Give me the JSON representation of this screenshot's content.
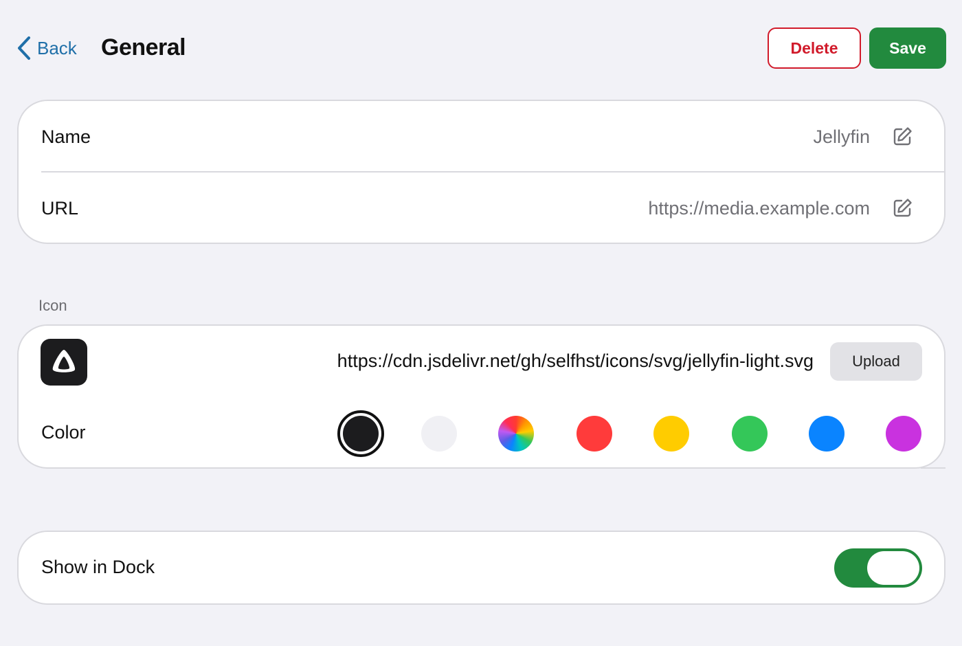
{
  "header": {
    "back_label": "Back",
    "title": "General",
    "delete_label": "Delete",
    "save_label": "Save"
  },
  "fields": {
    "name_label": "Name",
    "name_value": "Jellyfin",
    "url_label": "URL",
    "url_value": "https://media.example.com"
  },
  "icon_section": {
    "section_label": "Icon",
    "icon_url": "https://cdn.jsdelivr.net/gh/selfhst/icons/svg/jellyfin-light.svg",
    "upload_label": "Upload",
    "color_label": "Color",
    "colors": [
      {
        "name": "black",
        "value": "#1c1c1e",
        "selected": true
      },
      {
        "name": "light",
        "value": "#f0f0f4",
        "selected": false
      },
      {
        "name": "rainbow",
        "value": "conic",
        "selected": false
      },
      {
        "name": "red",
        "value": "#ff3b3b",
        "selected": false
      },
      {
        "name": "yellow",
        "value": "#ffcc00",
        "selected": false
      },
      {
        "name": "green",
        "value": "#34c759",
        "selected": false
      },
      {
        "name": "blue",
        "value": "#0a84ff",
        "selected": false
      },
      {
        "name": "purple",
        "value": "#c932df",
        "selected": false
      }
    ]
  },
  "dock": {
    "label": "Show in Dock",
    "enabled": true
  },
  "theme": {
    "accent": "#1f6fa8",
    "danger": "#d11a2a",
    "success": "#228a3e",
    "background": "#f2f2f7"
  }
}
